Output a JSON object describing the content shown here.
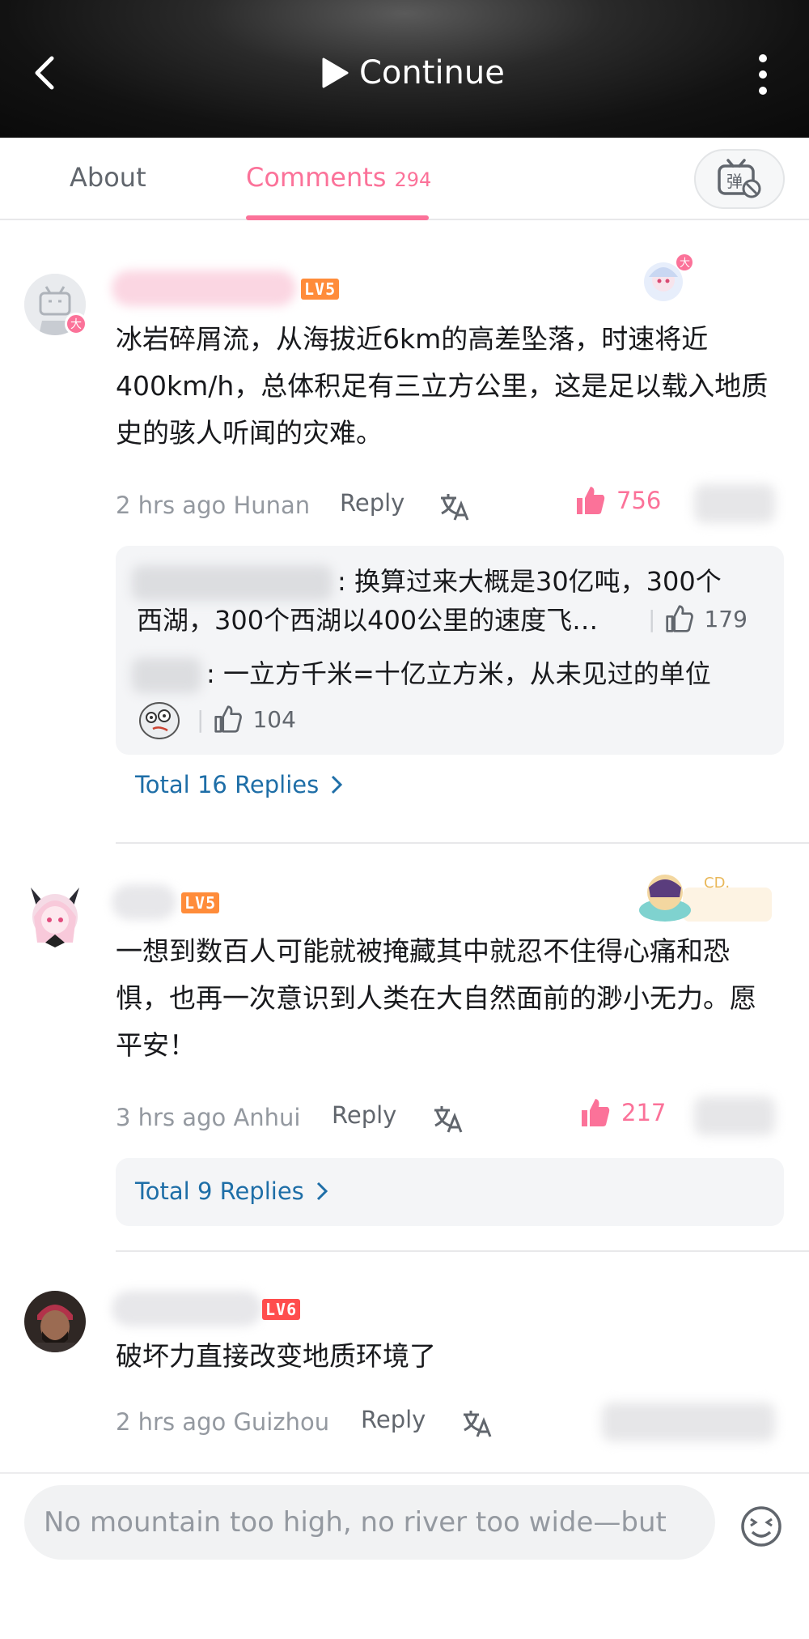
{
  "header": {
    "continue_label": "Continue"
  },
  "tabs": {
    "about": "About",
    "comments": "Comments",
    "comments_count": "294"
  },
  "comments": [
    {
      "level": "LV5",
      "text": "冰岩碎屑流，从海拔近6km的高差坠落，时速将近400km/h，总体积足有三立方公里，这是足以载入地质史的骇人听闻的灾难。",
      "time": "2 hrs ago",
      "location": "Hunan",
      "reply": "Reply",
      "likes": "756",
      "sub_replies": [
        {
          "text": ": 换算过来大概是30亿吨，300个西湖，300个西湖以400公里的速度飞…",
          "line1": ": 换算过来大概是30亿吨，300个",
          "line2": "西湖，300个西湖以400公里的速度飞…",
          "likes": "179"
        },
        {
          "text": ": 一立方千米=十亿立方米，从未见过的单位",
          "likes": "104"
        }
      ],
      "total_replies": "Total 16 Replies"
    },
    {
      "level": "LV5",
      "text": "一想到数百人可能就被掩藏其中就忍不住得心痛和恐惧，也再一次意识到人类在大自然面前的渺小无力。愿平安！",
      "time": "3 hrs ago",
      "location": "Anhui",
      "reply": "Reply",
      "likes": "217",
      "total_replies": "Total 9 Replies",
      "decor_label": "CD."
    },
    {
      "level": "LV6",
      "text": "破坏力直接改变地质环境了",
      "time": "2 hrs ago",
      "location": "Guizhou",
      "reply": "Reply"
    }
  ],
  "input": {
    "placeholder": "No mountain too high, no river too wide—but"
  },
  "colors": {
    "accent": "#fb7299",
    "link": "#1e6ea7",
    "meta": "#9499a0"
  }
}
